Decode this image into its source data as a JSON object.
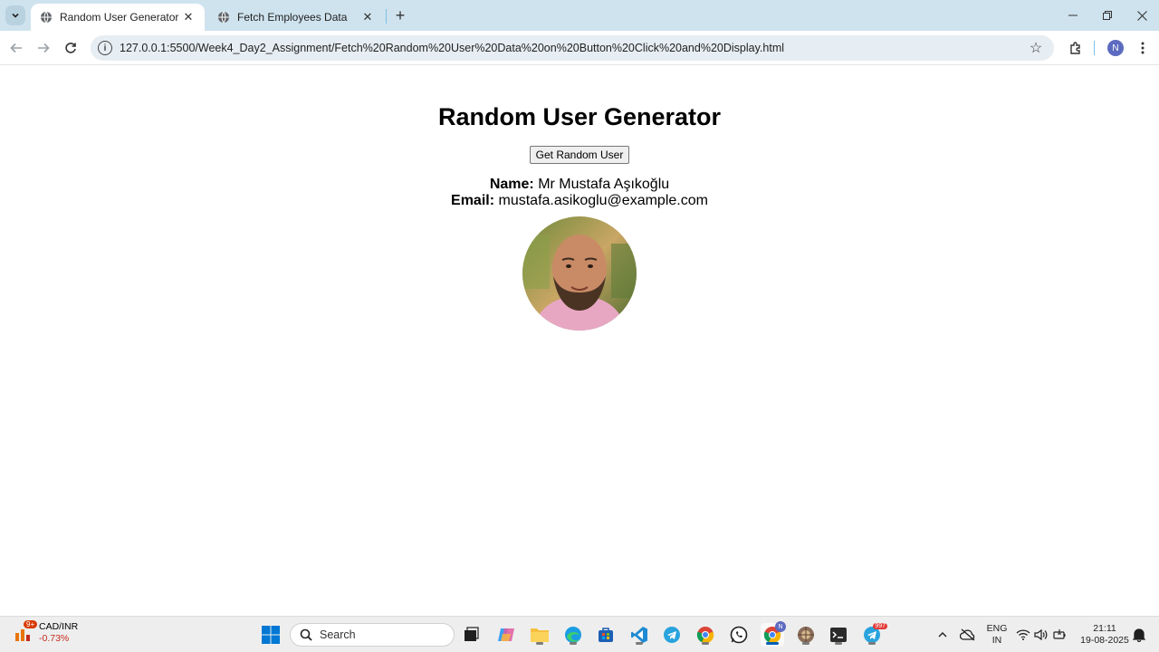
{
  "browser": {
    "tabs": [
      {
        "title": "Random User Generator",
        "active": true,
        "icon": "globe-icon"
      },
      {
        "title": "Fetch Employees Data",
        "active": false,
        "icon": "globe-icon"
      }
    ],
    "url": "127.0.0.1:5500/Week4_Day2_Assignment/Fetch%20Random%20User%20Data%20on%20Button%20Click%20and%20Display.html",
    "profile_initial": "N"
  },
  "page": {
    "heading": "Random User Generator",
    "button_label": "Get Random User",
    "name_label": "Name:",
    "name_value": "Mr Mustafa Aşıkoğlu",
    "email_label": "Email:",
    "email_value": "mustafa.asikoglu@example.com"
  },
  "taskbar": {
    "widget_badge": "9+",
    "widget_title": "CAD/INR",
    "widget_change": "-0.73%",
    "search_placeholder": "Search",
    "telegram_badge": "997",
    "chrome_profile_badge": "N",
    "lang_line1": "ENG",
    "lang_line2": "IN",
    "time": "21:11",
    "date": "19-08-2025"
  },
  "colors": {
    "tabstrip_bg": "#cfe3ee",
    "omnibox_bg": "#e6eef3",
    "accent_blue": "#005fb8",
    "negative_red": "#c42b1c"
  }
}
